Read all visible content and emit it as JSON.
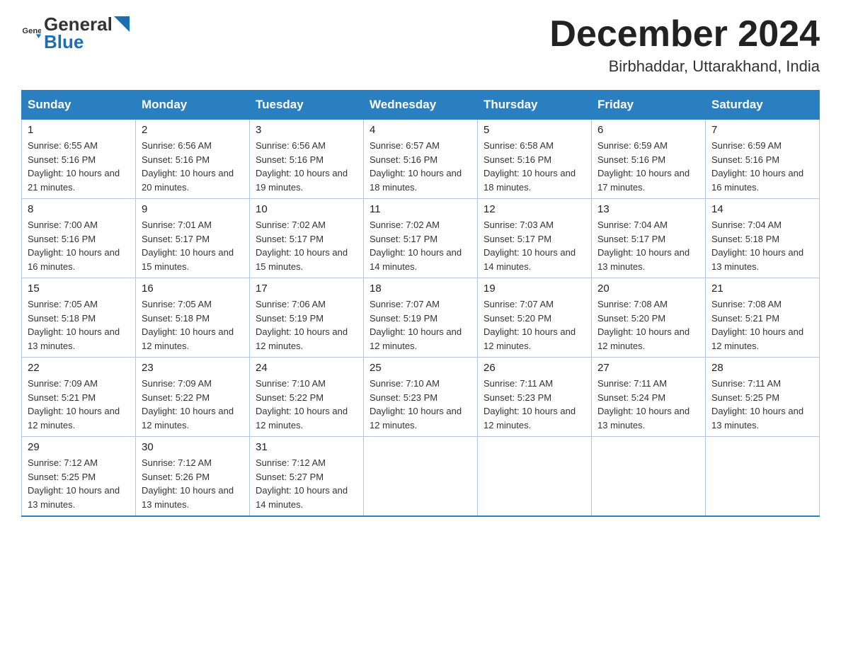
{
  "header": {
    "logo_general": "General",
    "logo_blue": "Blue",
    "month_title": "December 2024",
    "location": "Birbhaddar, Uttarakhand, India"
  },
  "days_of_week": [
    "Sunday",
    "Monday",
    "Tuesday",
    "Wednesday",
    "Thursday",
    "Friday",
    "Saturday"
  ],
  "weeks": [
    [
      {
        "day": "1",
        "sunrise": "6:55 AM",
        "sunset": "5:16 PM",
        "daylight": "10 hours and 21 minutes."
      },
      {
        "day": "2",
        "sunrise": "6:56 AM",
        "sunset": "5:16 PM",
        "daylight": "10 hours and 20 minutes."
      },
      {
        "day": "3",
        "sunrise": "6:56 AM",
        "sunset": "5:16 PM",
        "daylight": "10 hours and 19 minutes."
      },
      {
        "day": "4",
        "sunrise": "6:57 AM",
        "sunset": "5:16 PM",
        "daylight": "10 hours and 18 minutes."
      },
      {
        "day": "5",
        "sunrise": "6:58 AM",
        "sunset": "5:16 PM",
        "daylight": "10 hours and 18 minutes."
      },
      {
        "day": "6",
        "sunrise": "6:59 AM",
        "sunset": "5:16 PM",
        "daylight": "10 hours and 17 minutes."
      },
      {
        "day": "7",
        "sunrise": "6:59 AM",
        "sunset": "5:16 PM",
        "daylight": "10 hours and 16 minutes."
      }
    ],
    [
      {
        "day": "8",
        "sunrise": "7:00 AM",
        "sunset": "5:16 PM",
        "daylight": "10 hours and 16 minutes."
      },
      {
        "day": "9",
        "sunrise": "7:01 AM",
        "sunset": "5:17 PM",
        "daylight": "10 hours and 15 minutes."
      },
      {
        "day": "10",
        "sunrise": "7:02 AM",
        "sunset": "5:17 PM",
        "daylight": "10 hours and 15 minutes."
      },
      {
        "day": "11",
        "sunrise": "7:02 AM",
        "sunset": "5:17 PM",
        "daylight": "10 hours and 14 minutes."
      },
      {
        "day": "12",
        "sunrise": "7:03 AM",
        "sunset": "5:17 PM",
        "daylight": "10 hours and 14 minutes."
      },
      {
        "day": "13",
        "sunrise": "7:04 AM",
        "sunset": "5:17 PM",
        "daylight": "10 hours and 13 minutes."
      },
      {
        "day": "14",
        "sunrise": "7:04 AM",
        "sunset": "5:18 PM",
        "daylight": "10 hours and 13 minutes."
      }
    ],
    [
      {
        "day": "15",
        "sunrise": "7:05 AM",
        "sunset": "5:18 PM",
        "daylight": "10 hours and 13 minutes."
      },
      {
        "day": "16",
        "sunrise": "7:05 AM",
        "sunset": "5:18 PM",
        "daylight": "10 hours and 12 minutes."
      },
      {
        "day": "17",
        "sunrise": "7:06 AM",
        "sunset": "5:19 PM",
        "daylight": "10 hours and 12 minutes."
      },
      {
        "day": "18",
        "sunrise": "7:07 AM",
        "sunset": "5:19 PM",
        "daylight": "10 hours and 12 minutes."
      },
      {
        "day": "19",
        "sunrise": "7:07 AM",
        "sunset": "5:20 PM",
        "daylight": "10 hours and 12 minutes."
      },
      {
        "day": "20",
        "sunrise": "7:08 AM",
        "sunset": "5:20 PM",
        "daylight": "10 hours and 12 minutes."
      },
      {
        "day": "21",
        "sunrise": "7:08 AM",
        "sunset": "5:21 PM",
        "daylight": "10 hours and 12 minutes."
      }
    ],
    [
      {
        "day": "22",
        "sunrise": "7:09 AM",
        "sunset": "5:21 PM",
        "daylight": "10 hours and 12 minutes."
      },
      {
        "day": "23",
        "sunrise": "7:09 AM",
        "sunset": "5:22 PM",
        "daylight": "10 hours and 12 minutes."
      },
      {
        "day": "24",
        "sunrise": "7:10 AM",
        "sunset": "5:22 PM",
        "daylight": "10 hours and 12 minutes."
      },
      {
        "day": "25",
        "sunrise": "7:10 AM",
        "sunset": "5:23 PM",
        "daylight": "10 hours and 12 minutes."
      },
      {
        "day": "26",
        "sunrise": "7:11 AM",
        "sunset": "5:23 PM",
        "daylight": "10 hours and 12 minutes."
      },
      {
        "day": "27",
        "sunrise": "7:11 AM",
        "sunset": "5:24 PM",
        "daylight": "10 hours and 13 minutes."
      },
      {
        "day": "28",
        "sunrise": "7:11 AM",
        "sunset": "5:25 PM",
        "daylight": "10 hours and 13 minutes."
      }
    ],
    [
      {
        "day": "29",
        "sunrise": "7:12 AM",
        "sunset": "5:25 PM",
        "daylight": "10 hours and 13 minutes."
      },
      {
        "day": "30",
        "sunrise": "7:12 AM",
        "sunset": "5:26 PM",
        "daylight": "10 hours and 13 minutes."
      },
      {
        "day": "31",
        "sunrise": "7:12 AM",
        "sunset": "5:27 PM",
        "daylight": "10 hours and 14 minutes."
      },
      null,
      null,
      null,
      null
    ]
  ]
}
